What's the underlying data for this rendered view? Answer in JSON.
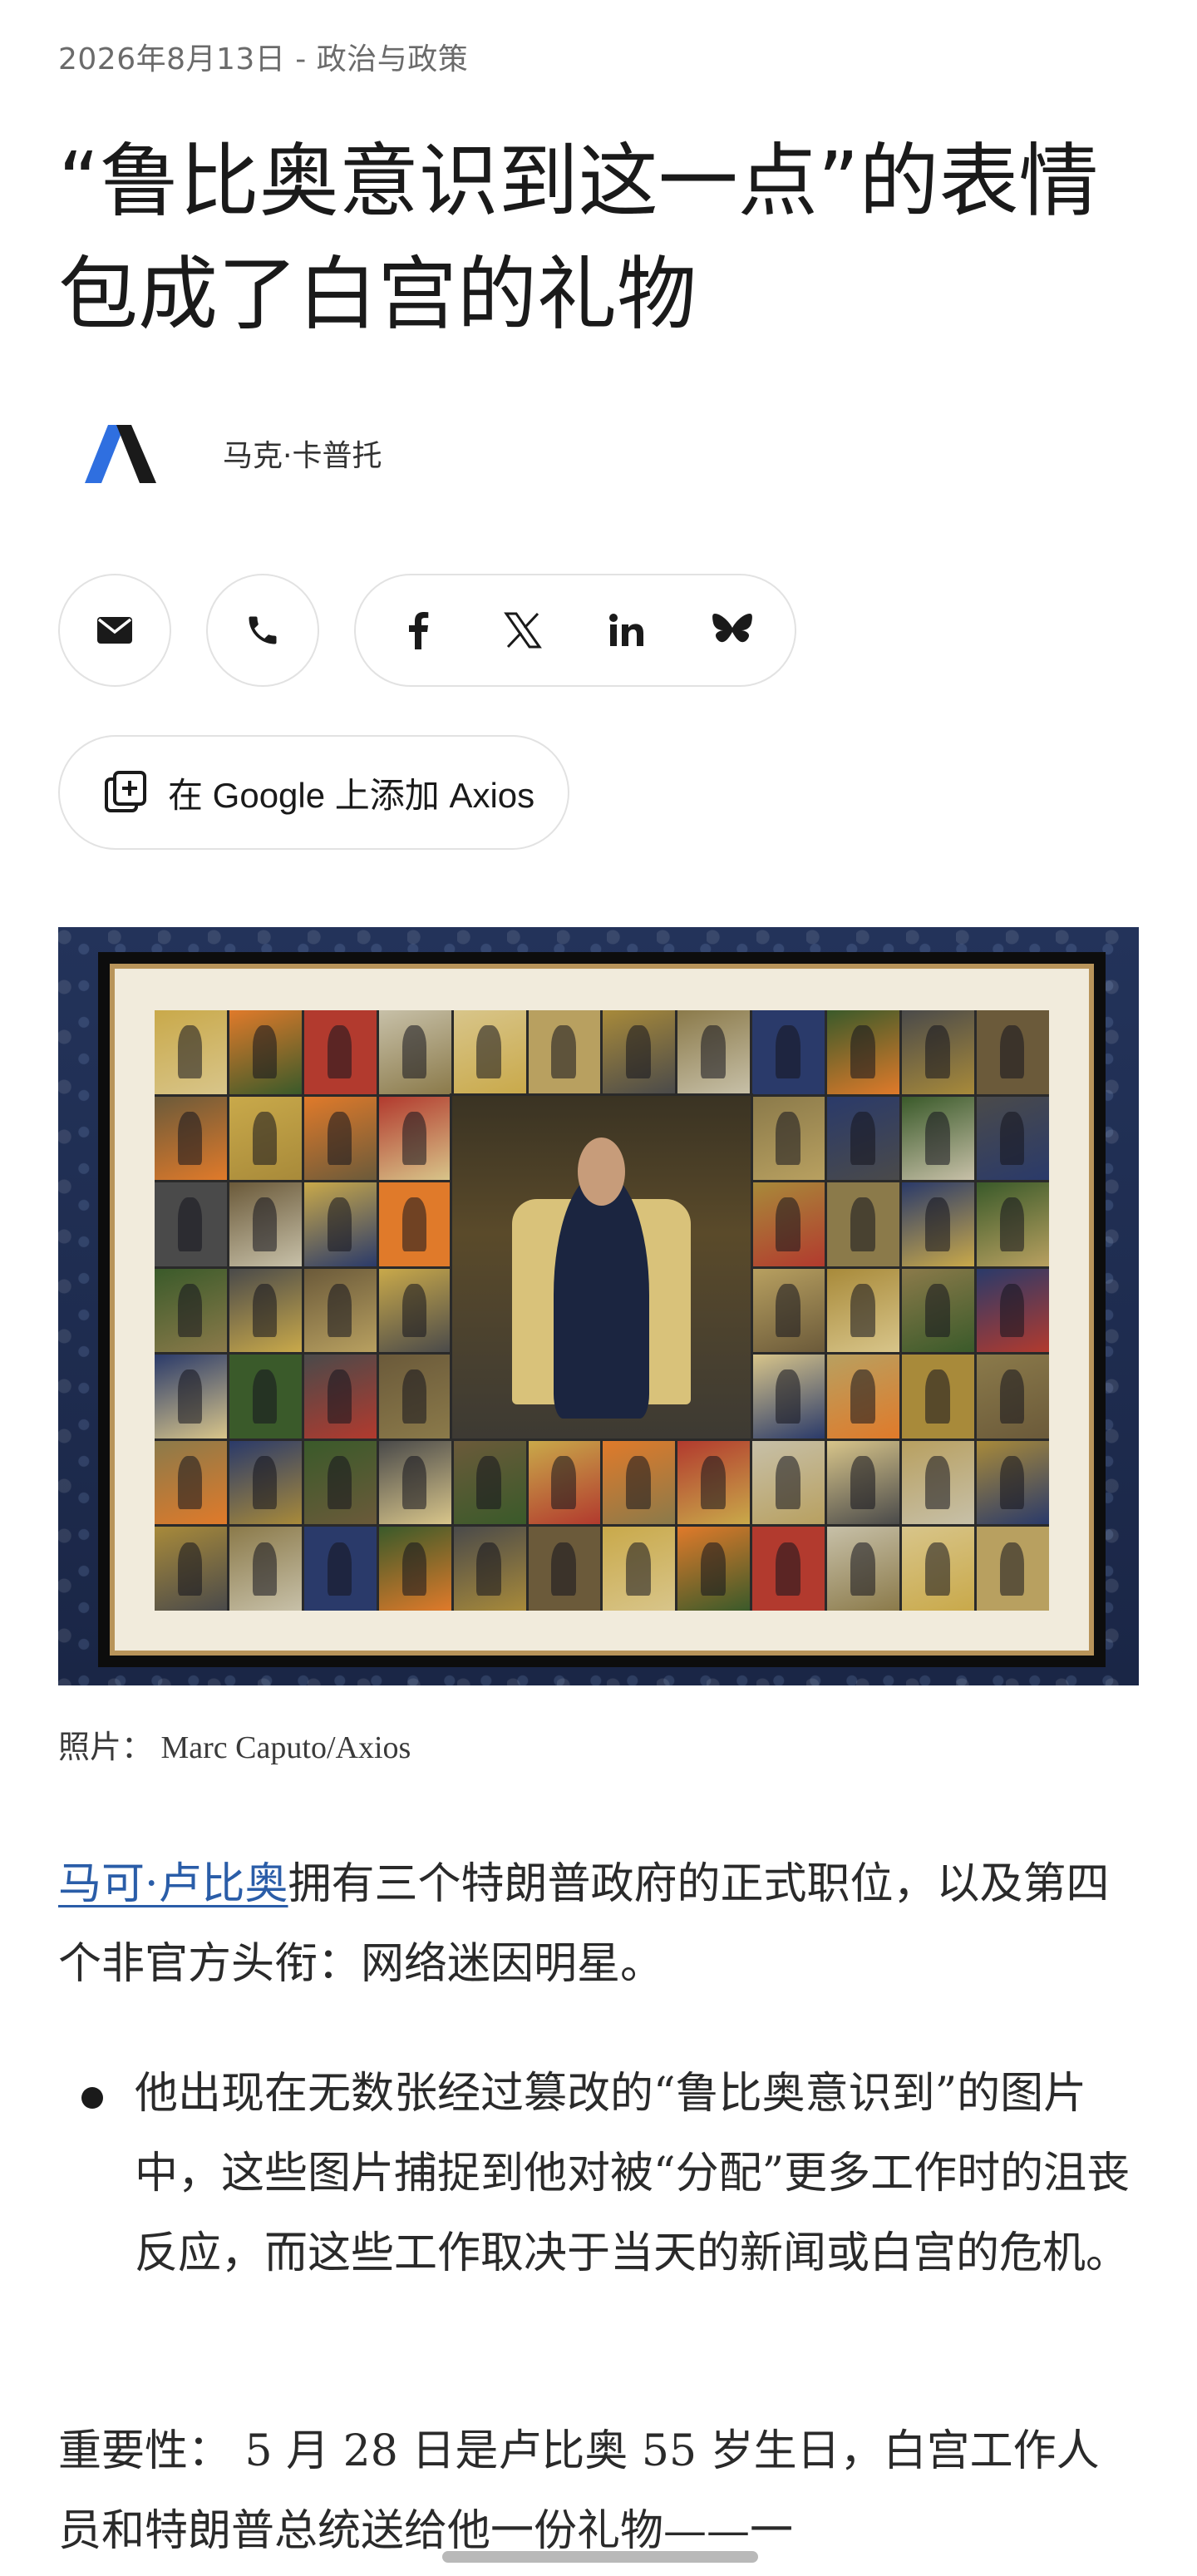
{
  "article": {
    "dateline": "2026年8月13日 - 政治与政策",
    "headline": "“鲁比奥意识到这一点”的表情包成了白宫的礼物",
    "author": "马克·卡普托"
  },
  "share": {
    "email": "email-icon",
    "phone": "phone-icon",
    "facebook": "facebook-icon",
    "x": "x-icon",
    "linkedin": "linkedin-icon",
    "bluesky": "bluesky-icon",
    "google_label": "在 Google 上添加 Axios"
  },
  "photo": {
    "caption": "照片： Marc Caputo/Axios"
  },
  "body": {
    "p1_link": "马可·卢比奥",
    "p1_rest": "拥有三个特朗普政府的正式职位，以及第四个非官方头衔：网络迷因明星。",
    "bullet1": "他出现在无数张经过篡改的“鲁比奥意识到”的图片中，这些图片捕捉到他对被“分配”更多工作时的沮丧反应，而这些工作取决于当天的新闻或白宫的危机。",
    "p2": "重要性： 5 月 28 日是卢比奥 55 岁生日，白宫工作人员和特朗普总统送给他一份礼物——一"
  },
  "colors": {
    "link": "#2a5da8",
    "logo_blue": "#2f6fe0",
    "logo_dark": "#1a1a1a"
  }
}
